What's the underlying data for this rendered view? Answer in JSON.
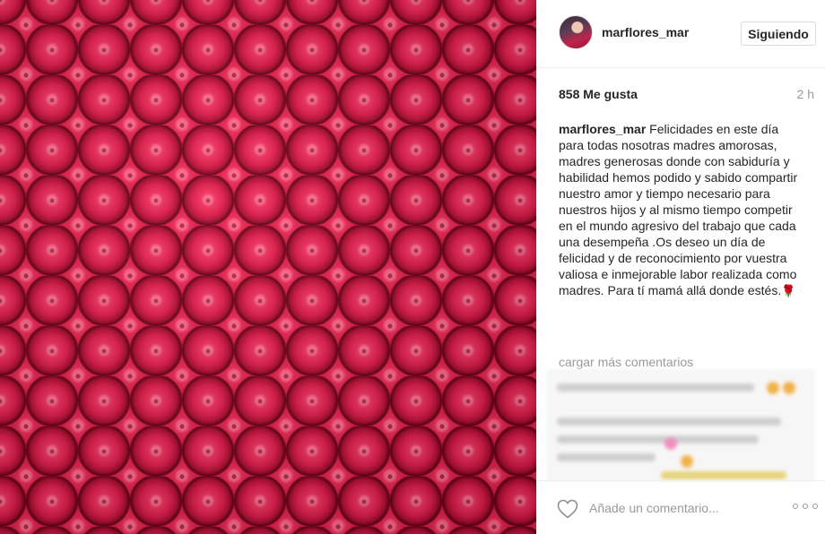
{
  "post": {
    "image_alt": "rosas rojas"
  },
  "header": {
    "username": "marflores_mar",
    "follow_label": "Siguiendo"
  },
  "stats": {
    "likes": "858 Me gusta",
    "time_ago": "2 h"
  },
  "caption": {
    "username": "marflores_mar",
    "text": "Felicidades en este día para todas nosotras madres amorosas, madres generosas donde con sabiduría y habilidad hemos podido y sabido compartir nuestro amor y tiempo necesario para nuestros hijos y al mismo tiempo competir en el mundo agresivo del trabajo que cada una desempeña .Os deseo un día de felicidad y de reconocimiento por vuestra valiosa e inmejorable labor realizada como madres. Para tí mamá allá donde estés.",
    "emoji": "🌹"
  },
  "comments": {
    "load_more_label": "cargar más comentarios"
  },
  "footer": {
    "comment_placeholder": "Añade un comentario..."
  },
  "colors": {
    "text": "#262626",
    "muted": "#999999",
    "border": "#efefef",
    "rose": "#c8103a"
  },
  "icons": [
    "heart-icon",
    "more-options-icon",
    "rose-emoji-icon"
  ]
}
